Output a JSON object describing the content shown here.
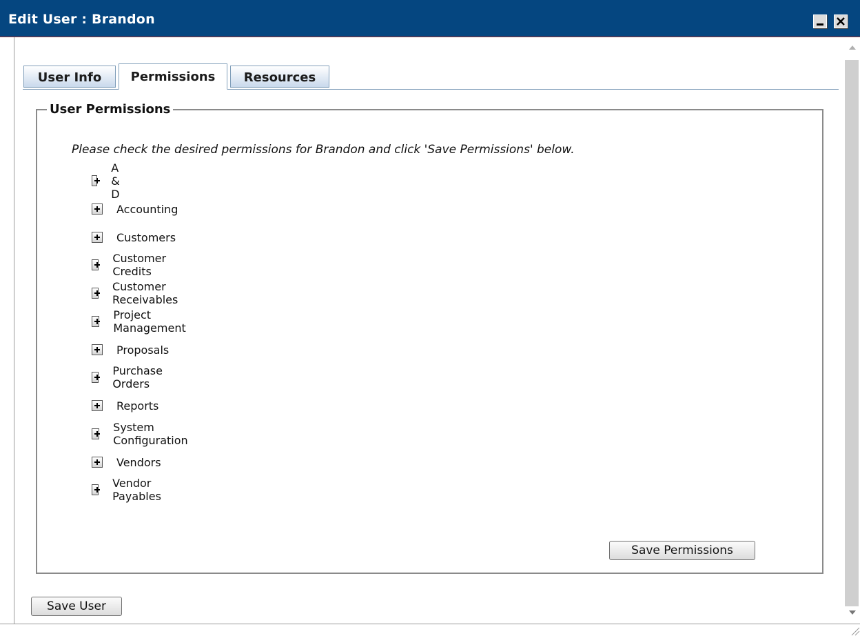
{
  "window": {
    "title": "Edit User : Brandon",
    "colors": {
      "titlebar": "#054680",
      "tab_border": "#7f9db9"
    }
  },
  "tabs": [
    {
      "label": "User Info",
      "active": false
    },
    {
      "label": "Permissions",
      "active": true
    },
    {
      "label": "Resources",
      "active": false
    }
  ],
  "permissions_panel": {
    "legend": "User Permissions",
    "instruction": "Please check the desired permissions for Brandon and click 'Save Permissions' below.",
    "nodes": [
      {
        "label": "A & D",
        "icon": "expand-plus-icon"
      },
      {
        "label": "Accounting",
        "icon": "expand-plus-icon"
      },
      {
        "label": "Customers",
        "icon": "expand-plus-icon"
      },
      {
        "label": "Customer Credits",
        "icon": "expand-plus-icon"
      },
      {
        "label": "Customer Receivables",
        "icon": "expand-plus-icon"
      },
      {
        "label": "Project Management",
        "icon": "expand-plus-icon"
      },
      {
        "label": "Proposals",
        "icon": "expand-plus-icon"
      },
      {
        "label": "Purchase Orders",
        "icon": "expand-plus-icon"
      },
      {
        "label": "Reports",
        "icon": "expand-plus-icon"
      },
      {
        "label": "System Configuration",
        "icon": "expand-plus-icon"
      },
      {
        "label": "Vendors",
        "icon": "expand-plus-icon"
      },
      {
        "label": "Vendor Payables",
        "icon": "expand-plus-icon"
      }
    ],
    "save_button": "Save Permissions"
  },
  "footer": {
    "save_user_button": "Save User"
  }
}
